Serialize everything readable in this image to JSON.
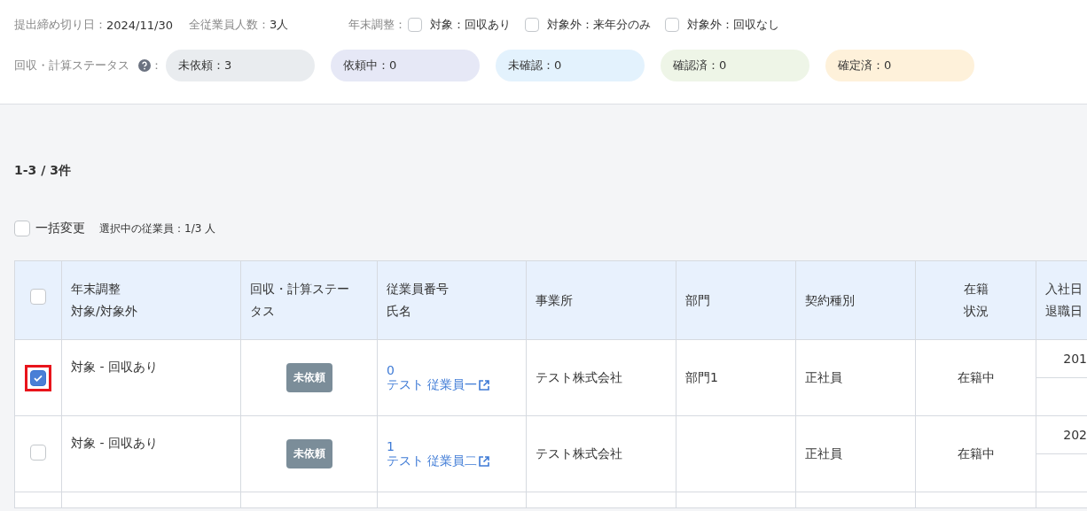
{
  "summary": {
    "deadline_label": "提出締め切り日：",
    "deadline": "2024/11/30",
    "employees_label": "全従業員人数：",
    "employees": "3人"
  },
  "year_end_filter": {
    "label": "年末調整：",
    "options": [
      {
        "label": "対象：回収あり",
        "checked": false
      },
      {
        "label": "対象外：来年分のみ",
        "checked": false
      },
      {
        "label": "対象外：回収なし",
        "checked": false
      }
    ]
  },
  "status_summary": {
    "label": "回収・計算ステータス",
    "colon": "：",
    "pills": [
      {
        "label": "未依頼：3",
        "color": "#e9ecef"
      },
      {
        "label": "依頼中：0",
        "color": "#e6e8f6"
      },
      {
        "label": "未確認：0",
        "color": "#e3f2fd"
      },
      {
        "label": "確認済：0",
        "color": "#eef5e7"
      },
      {
        "label": "確定済：0",
        "color": "#fef1da"
      }
    ]
  },
  "count": "1-3 / 3件",
  "bulk": {
    "label": "一括変更",
    "checked": false,
    "selected_info": "選択中の従業員：1/3 人"
  },
  "table": {
    "header_checked": false,
    "columns": [
      {
        "lines": [
          "年末調整",
          "対象/対象外"
        ]
      },
      {
        "lines": [
          "回収・計算ステー",
          "タス"
        ]
      },
      {
        "lines": [
          "従業員番号",
          "氏名"
        ]
      },
      {
        "lines": [
          "事業所"
        ]
      },
      {
        "lines": [
          "部門"
        ]
      },
      {
        "lines": [
          "契約種別"
        ]
      },
      {
        "lines": [
          "在籍",
          "状況"
        ]
      },
      {
        "lines": [
          "入社日",
          "退職日"
        ]
      }
    ],
    "rows": [
      {
        "checked": true,
        "highlighted": true,
        "year_end": "対象 - 回収あり",
        "status": "未依頼",
        "employee_number": "0",
        "name": "テスト 従業員一",
        "office": "テスト株式会社",
        "department": "部門1",
        "contract": "正社員",
        "enrollment": "在籍中",
        "hire_date": "201"
      },
      {
        "checked": false,
        "highlighted": false,
        "year_end": "対象 - 回収あり",
        "status": "未依頼",
        "employee_number": "1",
        "name": "テスト 従業員二",
        "office": "テスト株式会社",
        "department": "",
        "contract": "正社員",
        "enrollment": "在籍中",
        "hire_date": "202"
      }
    ]
  }
}
